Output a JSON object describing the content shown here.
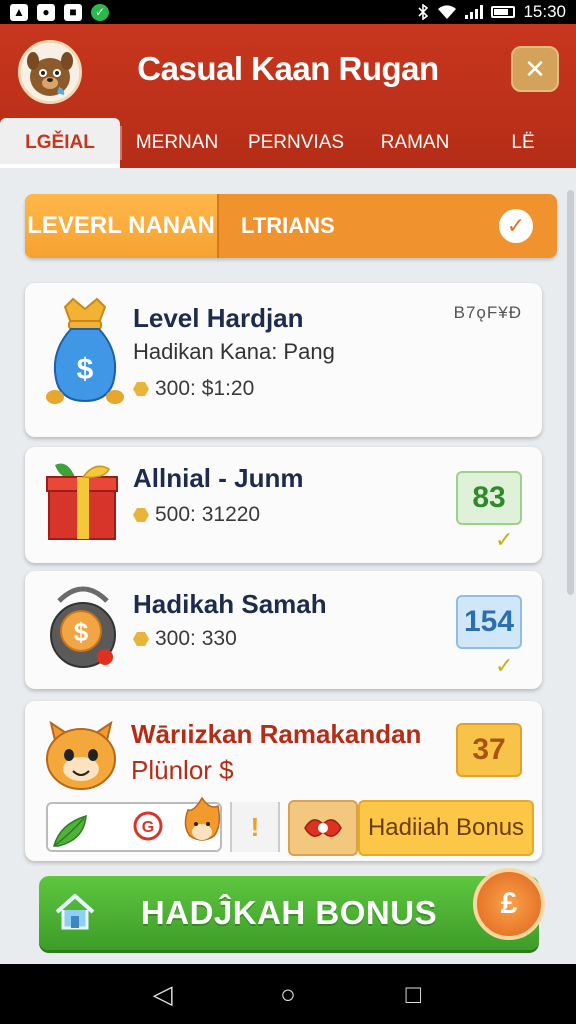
{
  "status_bar": {
    "left_icons": [
      "notification-icon-1",
      "notification-icon-2",
      "notification-icon-3",
      "notification-icon-4"
    ],
    "icon_glyphs": [
      "▲",
      "●",
      "■",
      "✓"
    ],
    "time": "15:30",
    "right_icons": [
      "bluetooth-icon",
      "wifi-icon",
      "signal-icon",
      "battery-icon"
    ]
  },
  "header": {
    "title": "Casual Kaan Rugan",
    "close_glyph": "✕",
    "tabs": [
      {
        "label": "LGĚIAL",
        "active": true
      },
      {
        "label": "MERNAN",
        "active": false
      },
      {
        "label": "PERNVIAS",
        "active": false
      },
      {
        "label": "RAMAN",
        "active": false
      },
      {
        "label": "LË",
        "active": false
      }
    ]
  },
  "filter": {
    "left_label": "LEVERL NANAN",
    "right_label": "LTRIANS",
    "check_glyph": "✓"
  },
  "cards": [
    {
      "icon": "money-bag-icon",
      "title": "Level Hardjan",
      "subtitle": "Hadikan Kana: Pang",
      "meta": "300: $1:20",
      "code": "B7ǫF¥Đ"
    },
    {
      "icon": "gift-box-icon",
      "title": "Allnial - Junm",
      "meta": "500: 31220",
      "score": "83",
      "tick": "✓"
    },
    {
      "icon": "coin-pot-icon",
      "title": "Hadikah Samah",
      "meta": "300: 330",
      "score": "154",
      "tick": "✓"
    },
    {
      "icon": "cat-face-icon",
      "title": "Wārıizkan Ramakandan",
      "subtitle": "Plünlor $",
      "score": "37"
    }
  ],
  "bonus_row": {
    "exclaim": "!",
    "bonus_label": "Hadiiah Bonus"
  },
  "cta": {
    "label": "HADĴKAH BONUS",
    "badge_glyph": "£"
  },
  "colors": {
    "header": "#c8361e",
    "filter": "#f0932e",
    "cta": "#4eb334",
    "score_green_bg": "#dff1d8",
    "score_blue_bg": "#cfe7f8",
    "score_orange_bg": "#f8c349"
  },
  "nav": {
    "back": "◁",
    "home": "○",
    "recents": "□"
  }
}
